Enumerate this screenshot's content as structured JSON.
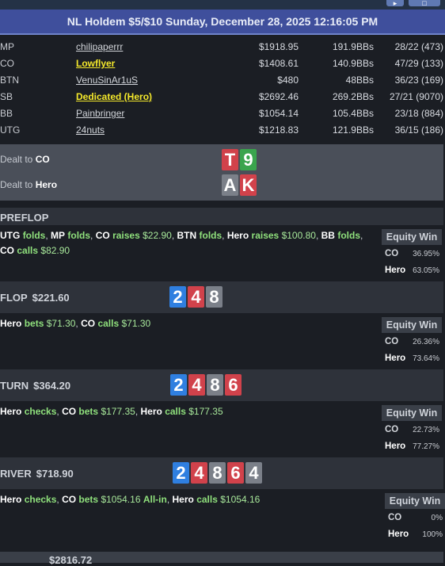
{
  "title": "NL Holdem $5/$10 Sunday, December 28, 2025 12:16:05 PM",
  "top_buttons": [
    {
      "icon": "chevron-icon"
    },
    {
      "icon": "chat-icon"
    }
  ],
  "players": [
    {
      "pos": "MP",
      "name": "chilipaperrr",
      "stack": "$1918.95",
      "bbs": "191.9BBs",
      "stats": "28/22 (473)",
      "highlight": false
    },
    {
      "pos": "CO",
      "name": "Lowflyer",
      "stack": "$1408.61",
      "bbs": "140.9BBs",
      "stats": "47/29 (133)",
      "highlight": true
    },
    {
      "pos": "BTN",
      "name": "VenuSinAr1uS",
      "stack": "$480",
      "bbs": "48BBs",
      "stats": "36/23 (169)",
      "highlight": false
    },
    {
      "pos": "SB",
      "name": "Dedicated (Hero)",
      "stack": "$2692.46",
      "bbs": "269.2BBs",
      "stats": "27/21 (9070)",
      "highlight": true
    },
    {
      "pos": "BB",
      "name": "Painbringer",
      "stack": "$1054.14",
      "bbs": "105.4BBs",
      "stats": "23/18 (884)",
      "highlight": false
    },
    {
      "pos": "UTG",
      "name": "24nuts",
      "stack": "$1218.83",
      "bbs": "121.9BBs",
      "stats": "36/15 (186)",
      "highlight": false
    }
  ],
  "dealt": [
    {
      "prefix": "Dealt to",
      "who": "CO",
      "cards": [
        {
          "rank": "T",
          "suit": "h"
        },
        {
          "rank": "9",
          "suit": "c"
        }
      ]
    },
    {
      "prefix": "Dealt to",
      "who": "Hero",
      "cards": [
        {
          "rank": "A",
          "suit": "s"
        },
        {
          "rank": "K",
          "suit": "h"
        }
      ]
    }
  ],
  "preflop": {
    "label": "PREFLOP",
    "actions": [
      {
        "who": "UTG",
        "verb": "folds"
      },
      {
        "who": "MP",
        "verb": "folds"
      },
      {
        "who": "CO",
        "verb": "raises",
        "amount": "$22.90"
      },
      {
        "who": "BTN",
        "verb": "folds"
      },
      {
        "who": "Hero",
        "verb": "raises",
        "amount": "$100.80"
      },
      {
        "who": "BB",
        "verb": "folds"
      },
      {
        "who": "CO",
        "verb": "calls",
        "amount": "$82.90"
      }
    ],
    "equity": {
      "header": "Equity Win",
      "rows": [
        {
          "player": "CO",
          "value": "36.95%"
        },
        {
          "player": "Hero",
          "value": "63.05%"
        }
      ]
    }
  },
  "flop": {
    "label": "FLOP",
    "pot": "$221.60",
    "board": [
      {
        "rank": "2",
        "suit": "d"
      },
      {
        "rank": "4",
        "suit": "h"
      },
      {
        "rank": "8",
        "suit": "s"
      }
    ],
    "actions": [
      {
        "who": "Hero",
        "verb": "bets",
        "amount": "$71.30"
      },
      {
        "who": "CO",
        "verb": "calls",
        "amount": "$71.30"
      }
    ],
    "equity": {
      "header": "Equity Win",
      "rows": [
        {
          "player": "CO",
          "value": "26.36%"
        },
        {
          "player": "Hero",
          "value": "73.64%"
        }
      ]
    }
  },
  "turn": {
    "label": "TURN",
    "pot": "$364.20",
    "board": [
      {
        "rank": "2",
        "suit": "d"
      },
      {
        "rank": "4",
        "suit": "h"
      },
      {
        "rank": "8",
        "suit": "s"
      },
      {
        "rank": "6",
        "suit": "h"
      }
    ],
    "actions": [
      {
        "who": "Hero",
        "verb": "checks"
      },
      {
        "who": "CO",
        "verb": "bets",
        "amount": "$177.35"
      },
      {
        "who": "Hero",
        "verb": "calls",
        "amount": "$177.35"
      }
    ],
    "equity": {
      "header": "Equity Win",
      "rows": [
        {
          "player": "CO",
          "value": "22.73%"
        },
        {
          "player": "Hero",
          "value": "77.27%"
        }
      ]
    }
  },
  "river": {
    "label": "RIVER",
    "pot": "$718.90",
    "board": [
      {
        "rank": "2",
        "suit": "d"
      },
      {
        "rank": "4",
        "suit": "h"
      },
      {
        "rank": "8",
        "suit": "s"
      },
      {
        "rank": "6",
        "suit": "h"
      },
      {
        "rank": "4",
        "suit": "s"
      }
    ],
    "actions": [
      {
        "who": "Hero",
        "verb": "checks"
      },
      {
        "who": "CO",
        "verb": "bets",
        "amount": "$1054.16",
        "extra": "All-in"
      },
      {
        "who": "Hero",
        "verb": "calls",
        "amount": "$1054.16"
      }
    ],
    "equity": {
      "header": "Equity Win",
      "rows": [
        {
          "player": "CO",
          "value": "0%"
        },
        {
          "player": "Hero",
          "value": "100%"
        }
      ]
    }
  },
  "summary_partial": "$2816.72"
}
